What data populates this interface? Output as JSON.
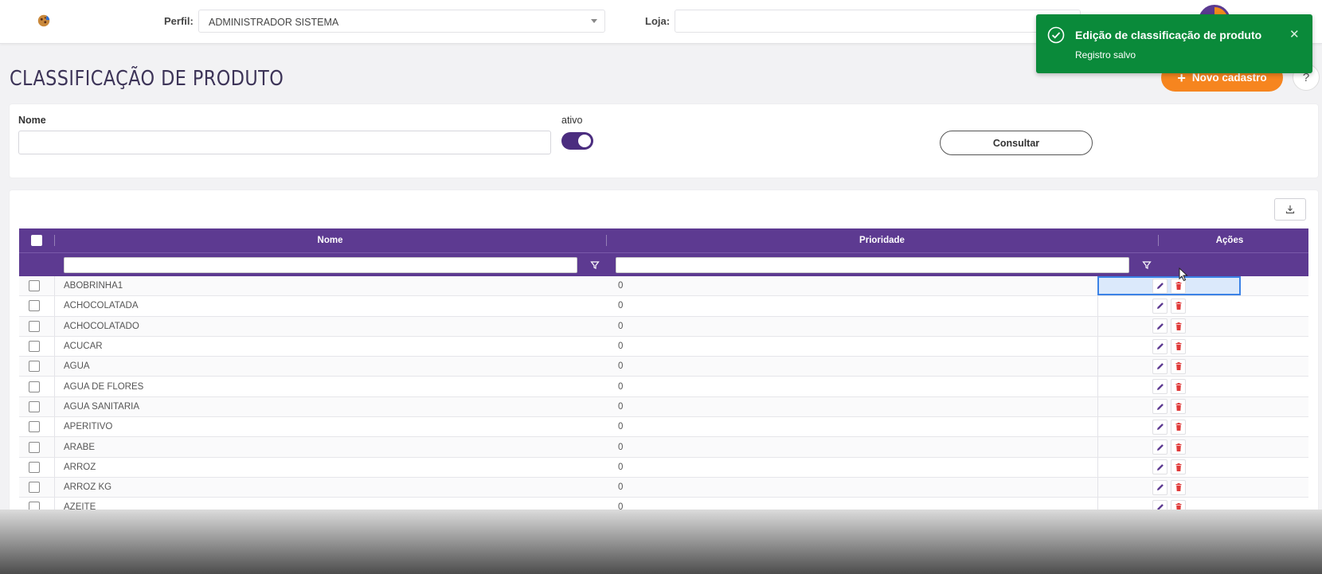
{
  "header": {
    "perfil_label": "Perfil:",
    "perfil_value": "ADMINISTRADOR SISTEMA",
    "loja_label": "Loja:",
    "loja_value": ""
  },
  "page": {
    "title": "CLASSIFICAÇÃO DE PRODUTO",
    "new_button": "Novo cadastro",
    "help": "?"
  },
  "filters": {
    "name_label": "Nome",
    "name_value": "",
    "active_label": "ativo",
    "active_on": true,
    "consult_button": "Consultar"
  },
  "grid": {
    "columns": [
      "Nome",
      "Prioridade",
      "Ações"
    ],
    "rows": [
      {
        "nome": "ABOBRINHA1",
        "prioridade": "0"
      },
      {
        "nome": "ACHOCOLATADA",
        "prioridade": "0"
      },
      {
        "nome": "ACHOCOLATADO",
        "prioridade": "0"
      },
      {
        "nome": "ACUCAR",
        "prioridade": "0"
      },
      {
        "nome": "AGUA",
        "prioridade": "0"
      },
      {
        "nome": "AGUA DE FLORES",
        "prioridade": "0"
      },
      {
        "nome": "AGUA SANITARIA",
        "prioridade": "0"
      },
      {
        "nome": "APERITIVO",
        "prioridade": "0"
      },
      {
        "nome": "ARABE",
        "prioridade": "0"
      },
      {
        "nome": "ARROZ",
        "prioridade": "0"
      },
      {
        "nome": "ARROZ KG",
        "prioridade": "0"
      },
      {
        "nome": "AZEITE",
        "prioridade": "0"
      }
    ]
  },
  "toast": {
    "title": "Edição de classificação de produto",
    "message": "Registro salvo",
    "color": "#0a8a3a"
  },
  "colors": {
    "primary": "#5d3a91",
    "accent": "#f6851f",
    "delete": "#e03a3a"
  }
}
